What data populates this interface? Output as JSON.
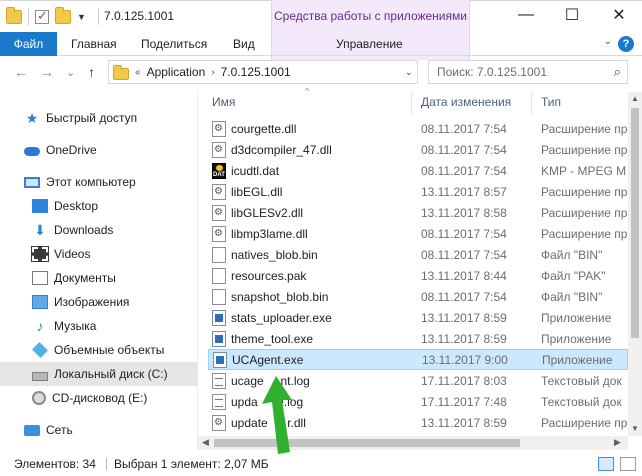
{
  "window": {
    "title": "7.0.125.1001",
    "contextual_group": "Средства работы с приложениями",
    "buttons": {
      "minimize": "—",
      "maximize": "☐",
      "close": "✕"
    }
  },
  "ribbon": {
    "tabs": [
      "Файл",
      "Главная",
      "Поделиться",
      "Вид",
      "Управление"
    ],
    "help": "?"
  },
  "navigation": {
    "back": "←",
    "forward": "→",
    "recent": "⌄",
    "up": "↑",
    "breadcrumb": [
      "Application",
      "7.0.125.1001"
    ],
    "overflow": "«",
    "search_placeholder": "Поиск: 7.0.125.1001"
  },
  "sidebar": {
    "items": [
      {
        "label": "Быстрый доступ",
        "icon": "star-icon"
      },
      {
        "label": "OneDrive",
        "icon": "cloud-icon"
      },
      {
        "label": "Этот компьютер",
        "icon": "computer-icon"
      },
      {
        "label": "Desktop",
        "icon": "desktop-icon"
      },
      {
        "label": "Downloads",
        "icon": "download-icon"
      },
      {
        "label": "Videos",
        "icon": "video-icon"
      },
      {
        "label": "Документы",
        "icon": "document-icon"
      },
      {
        "label": "Изображения",
        "icon": "image-icon"
      },
      {
        "label": "Музыка",
        "icon": "music-icon"
      },
      {
        "label": "Объемные объекты",
        "icon": "3d-objects-icon"
      },
      {
        "label": "Локальный диск (C:)",
        "icon": "drive-icon"
      },
      {
        "label": "CD-дисковод (E:)",
        "icon": "cd-drive-icon"
      },
      {
        "label": "Сеть",
        "icon": "network-icon"
      }
    ]
  },
  "filelist": {
    "columns": {
      "name": "Имя",
      "date": "Дата изменения",
      "type": "Тип"
    },
    "rows": [
      {
        "name": "courgette.dll",
        "date": "08.11.2017 7:54",
        "type": "Расширение пр",
        "icon": "dll-file-icon"
      },
      {
        "name": "d3dcompiler_47.dll",
        "date": "08.11.2017 7:54",
        "type": "Расширение пр",
        "icon": "dll-file-icon"
      },
      {
        "name": "icudtl.dat",
        "date": "08.11.2017 7:54",
        "type": "KMP - MPEG M",
        "icon": "dat-file-icon"
      },
      {
        "name": "libEGL.dll",
        "date": "13.11.2017 8:57",
        "type": "Расширение пр",
        "icon": "dll-file-icon"
      },
      {
        "name": "libGLESv2.dll",
        "date": "13.11.2017 8:58",
        "type": "Расширение пр",
        "icon": "dll-file-icon"
      },
      {
        "name": "libmp3lame.dll",
        "date": "08.11.2017 7:54",
        "type": "Расширение пр",
        "icon": "dll-file-icon"
      },
      {
        "name": "natives_blob.bin",
        "date": "08.11.2017 7:54",
        "type": "Файл \"BIN\"",
        "icon": "file-icon"
      },
      {
        "name": "resources.pak",
        "date": "13.11.2017 8:44",
        "type": "Файл \"PAK\"",
        "icon": "file-icon"
      },
      {
        "name": "snapshot_blob.bin",
        "date": "08.11.2017 7:54",
        "type": "Файл \"BIN\"",
        "icon": "file-icon"
      },
      {
        "name": "stats_uploader.exe",
        "date": "13.11.2017 8:59",
        "type": "Приложение",
        "icon": "exe-file-icon"
      },
      {
        "name": "theme_tool.exe",
        "date": "13.11.2017 8:59",
        "type": "Приложение",
        "icon": "exe-file-icon"
      },
      {
        "name": "UCAgent.exe",
        "date": "13.11.2017 9:00",
        "type": "Приложение",
        "icon": "exe-file-icon"
      },
      {
        "name": "ucage",
        "name_tail": "nt.log",
        "date": "17.11.2017 8:03",
        "type": "Текстовый док",
        "icon": "text-file-icon"
      },
      {
        "name": "upda",
        "name_tail": "te.log",
        "date": "17.11.2017 7:48",
        "type": "Текстовый док",
        "icon": "text-file-icon"
      },
      {
        "name": "update",
        "name_tail": "r.dll",
        "date": "13.11.2017 8:59",
        "type": "Расширение пр",
        "icon": "dll-file-icon"
      }
    ],
    "selected_index": 11
  },
  "statusbar": {
    "count": "Элементов: 34",
    "selection": "Выбран 1 элемент: 2,07 МБ"
  },
  "colors": {
    "file_tab": "#1979ca",
    "contextual": "#6b2a8b",
    "selection": "#cce8ff",
    "annotation_arrow": "#2fb02f"
  }
}
